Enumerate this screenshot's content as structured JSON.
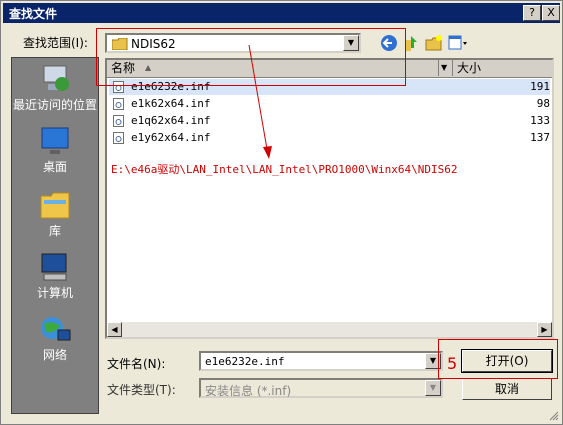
{
  "window": {
    "title": "查找文件",
    "help": "?",
    "close": "X"
  },
  "lookin": {
    "label": "查找范围(I):",
    "value": "NDIS62"
  },
  "places": [
    {
      "label": "最近访问的位置",
      "icon": "recent-places-icon"
    },
    {
      "label": "桌面",
      "icon": "desktop-icon"
    },
    {
      "label": "库",
      "icon": "libraries-icon"
    },
    {
      "label": "计算机",
      "icon": "computer-icon"
    },
    {
      "label": "网络",
      "icon": "network-icon"
    }
  ],
  "list": {
    "columns": {
      "name": "名称",
      "size": "大小"
    },
    "files": [
      {
        "name": "e1e6232e.inf",
        "size": "191"
      },
      {
        "name": "e1k62x64.inf",
        "size": "98"
      },
      {
        "name": "e1q62x64.inf",
        "size": "133"
      },
      {
        "name": "e1y62x64.inf",
        "size": "137"
      }
    ]
  },
  "annotation": {
    "path": "E:\\e46a驱动\\LAN_Intel\\LAN_Intel\\PRO1000\\Winx64\\NDIS62",
    "step": "5",
    "color": "#d00000"
  },
  "filename": {
    "label": "文件名(N):",
    "value": "e1e6232e.inf"
  },
  "filetype": {
    "label": "文件类型(T):",
    "value": "安装信息 (*.inf)"
  },
  "buttons": {
    "open": "打开(O)",
    "cancel": "取消"
  }
}
